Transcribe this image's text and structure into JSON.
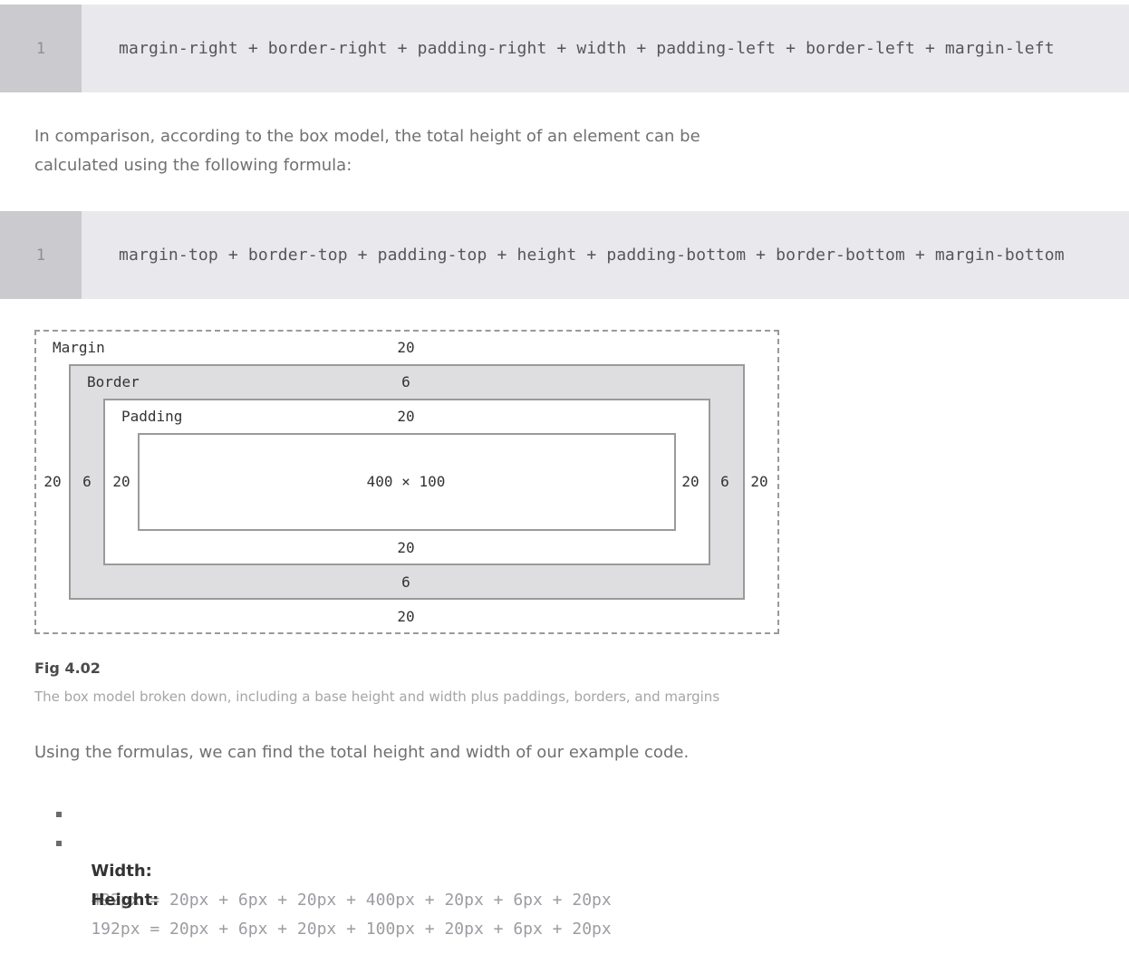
{
  "code_width": {
    "line_number": "1",
    "code": "margin-right + border-right + padding-right + width + padding-left + border-left + margin-left"
  },
  "paragraph_height": "In comparison, according to the box model, the total height of an element can be calculated using the following formula:",
  "code_height": {
    "line_number": "1",
    "code": "margin-top + border-top + padding-top + height + padding-bottom + border-bottom + margin-bottom"
  },
  "diagram": {
    "margin_label": "Margin",
    "border_label": "Border",
    "padding_label": "Padding",
    "margin_top": "20",
    "border_top": "6",
    "padding_top": "20",
    "content": "400 × 100",
    "padding_bottom": "20",
    "border_bottom": "6",
    "margin_bottom": "20",
    "margin_left": "20",
    "border_left": "6",
    "padding_left": "20",
    "padding_right": "20",
    "border_right": "6",
    "margin_right": "20"
  },
  "figure": {
    "title": "Fig 4.02",
    "caption": "The box model broken down, including a base height and width plus paddings, borders, and margins"
  },
  "paragraph_formulas": "Using the formulas, we can find the total height and width of our example code.",
  "results": [
    {
      "label": "Width:",
      "value": "492px = 20px + 6px + 20px + 400px + 20px + 6px + 20px"
    },
    {
      "label": "Height:",
      "value": "192px = 20px + 6px + 20px + 100px + 20px + 6px + 20px"
    }
  ]
}
